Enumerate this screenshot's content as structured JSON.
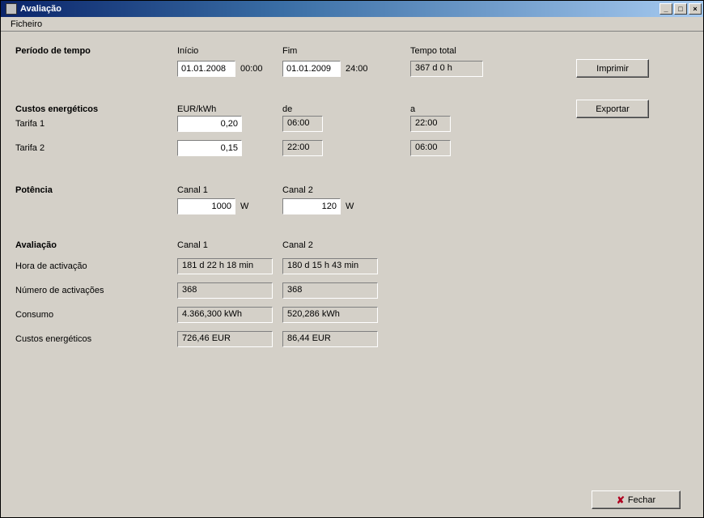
{
  "window": {
    "title": "Avaliação"
  },
  "menu": {
    "ficheiro": "Ficheiro"
  },
  "sections": {
    "periodo": {
      "heading": "Período de tempo",
      "inicio_label": "Início",
      "inicio_value": "01.01.2008",
      "inicio_time": "00:00",
      "fim_label": "Fim",
      "fim_value": "01.01.2009",
      "fim_time": "24:00",
      "tempo_total_label": "Tempo total",
      "tempo_total_value": "367 d  0 h"
    },
    "custos": {
      "heading": "Custos energéticos",
      "eurkwh_label": "EUR/kWh",
      "de_label": "de",
      "a_label": "a",
      "tarifa1_label": "Tarifa 1",
      "tarifa1_rate": "0,20",
      "tarifa1_de": "06:00",
      "tarifa1_a": "22:00",
      "tarifa2_label": "Tarifa 2",
      "tarifa2_rate": "0,15",
      "tarifa2_de": "22:00",
      "tarifa2_a": "06:00"
    },
    "potencia": {
      "heading": "Potência",
      "canal1_label": "Canal  1",
      "canal1_value": "1000",
      "canal1_unit": "W",
      "canal2_label": "Canal  2",
      "canal2_value": "120",
      "canal2_unit": "W"
    },
    "avaliacao": {
      "heading": "Avaliação",
      "canal1_label": "Canal  1",
      "canal2_label": "Canal  2",
      "rows": {
        "hora": {
          "label": "Hora de activação",
          "c1": "181 d  22 h  18 min",
          "c2": "180 d  15 h  43 min"
        },
        "nact": {
          "label": "Número de activações",
          "c1": "368",
          "c2": "368"
        },
        "consumo": {
          "label": "Consumo",
          "c1": "4.366,300 kWh",
          "c2": "520,286 kWh"
        },
        "custos": {
          "label": "Custos energéticos",
          "c1": "726,46 EUR",
          "c2": "86,44 EUR"
        }
      }
    }
  },
  "buttons": {
    "imprimir": "Imprimir",
    "exportar": "Exportar",
    "fechar": "Fechar"
  },
  "window_controls": {
    "min": "_",
    "max": "□",
    "close": "×"
  }
}
